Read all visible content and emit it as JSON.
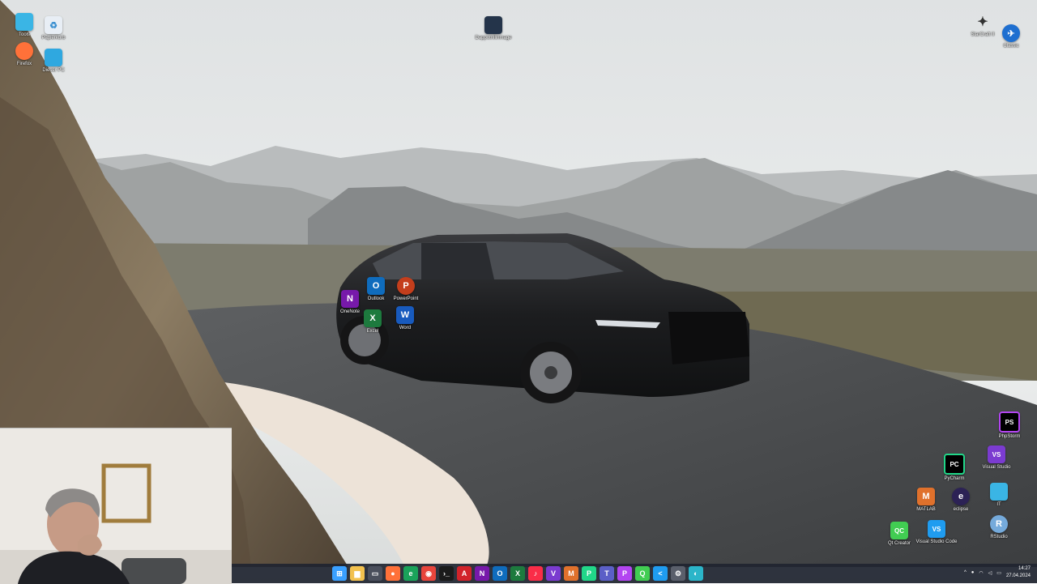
{
  "desktop_icons": {
    "tools": {
      "label": "Tools",
      "color": "#3ab5e5"
    },
    "recycle": {
      "label": "Papierkorb",
      "color": "#e8eef5"
    },
    "firefox": {
      "label": "Firefox",
      "color": "#ff7139"
    },
    "dieser_pc": {
      "label": "Dieser PC",
      "color": "#2fa8e0"
    },
    "image_file": {
      "label": "Dappotrillinmage",
      "color": "#24344a"
    },
    "starcraft": {
      "label": "StarCraft II",
      "color": "#3a4a5a"
    },
    "steam_like": {
      "label": "Classic",
      "color": "#1e6fd0"
    },
    "outlook": {
      "label": "Outlook",
      "color": "#0f6cbd",
      "glyph": "O"
    },
    "powerpoint": {
      "label": "PowerPoint",
      "color": "#c43e1c",
      "glyph": "P"
    },
    "onenote": {
      "label": "OneNote",
      "color": "#7719aa",
      "glyph": "N"
    },
    "excel": {
      "label": "Excel",
      "color": "#1d7a3e",
      "glyph": "X"
    },
    "word": {
      "label": "Word",
      "color": "#185abd",
      "glyph": "W"
    },
    "phpstorm": {
      "label": "PhpStorm",
      "color": "#b345f1",
      "glyph": "PS"
    },
    "visual_studio": {
      "label": "Visual Studio",
      "color": "#7b3bd0",
      "glyph": "VS"
    },
    "pycharm": {
      "label": "PyCharm",
      "color": "#21d789",
      "glyph": "PC"
    },
    "matlab": {
      "label": "MATLAB",
      "color": "#e0712c",
      "glyph": "M"
    },
    "eclipse": {
      "label": "eclipse",
      "color": "#2c2255",
      "glyph": "e"
    },
    "it_folder": {
      "label": "IT",
      "color": "#3ab5e5"
    },
    "qt_creator": {
      "label": "Qt Creator",
      "color": "#41cd52",
      "glyph": "QC"
    },
    "vscode": {
      "label": "Visual Studio Code",
      "color": "#1f9cf0",
      "glyph": "VS"
    },
    "rstudio": {
      "label": "RStudio",
      "color": "#75aadb",
      "glyph": "R"
    }
  },
  "taskbar": {
    "apps": [
      {
        "name": "start",
        "color": "#3aa0ff",
        "glyph": "⊞"
      },
      {
        "name": "explorer",
        "color": "#f2c14e",
        "glyph": "▆"
      },
      {
        "name": "task-view",
        "color": "#4a4f5c",
        "glyph": "▭"
      },
      {
        "name": "firefox",
        "color": "#ff7139",
        "glyph": "●"
      },
      {
        "name": "edge",
        "color": "#1aa35a",
        "glyph": "e"
      },
      {
        "name": "chrome",
        "color": "#e8453c",
        "glyph": "◉"
      },
      {
        "name": "terminal",
        "color": "#1b1b1b",
        "glyph": "›_"
      },
      {
        "name": "acrobat",
        "color": "#d2232a",
        "glyph": "A"
      },
      {
        "name": "onenote",
        "color": "#7719aa",
        "glyph": "N"
      },
      {
        "name": "outlook",
        "color": "#0f6cbd",
        "glyph": "O"
      },
      {
        "name": "excel",
        "color": "#1d7a3e",
        "glyph": "X"
      },
      {
        "name": "music",
        "color": "#fa2d48",
        "glyph": "♪"
      },
      {
        "name": "visual-studio",
        "color": "#7b3bd0",
        "glyph": "V"
      },
      {
        "name": "matlab",
        "color": "#e0712c",
        "glyph": "M"
      },
      {
        "name": "pycharm",
        "color": "#21d789",
        "glyph": "P"
      },
      {
        "name": "teams",
        "color": "#5b5fc7",
        "glyph": "T"
      },
      {
        "name": "phpstorm",
        "color": "#b345f1",
        "glyph": "P"
      },
      {
        "name": "qt-creator",
        "color": "#41cd52",
        "glyph": "Q"
      },
      {
        "name": "vscode",
        "color": "#1f9cf0",
        "glyph": "<"
      },
      {
        "name": "settings",
        "color": "#5a5f6b",
        "glyph": "⚙"
      },
      {
        "name": "network-app",
        "color": "#2bb5c9",
        "glyph": "◐"
      }
    ],
    "time": "14:27",
    "date": "27.04.2024"
  }
}
